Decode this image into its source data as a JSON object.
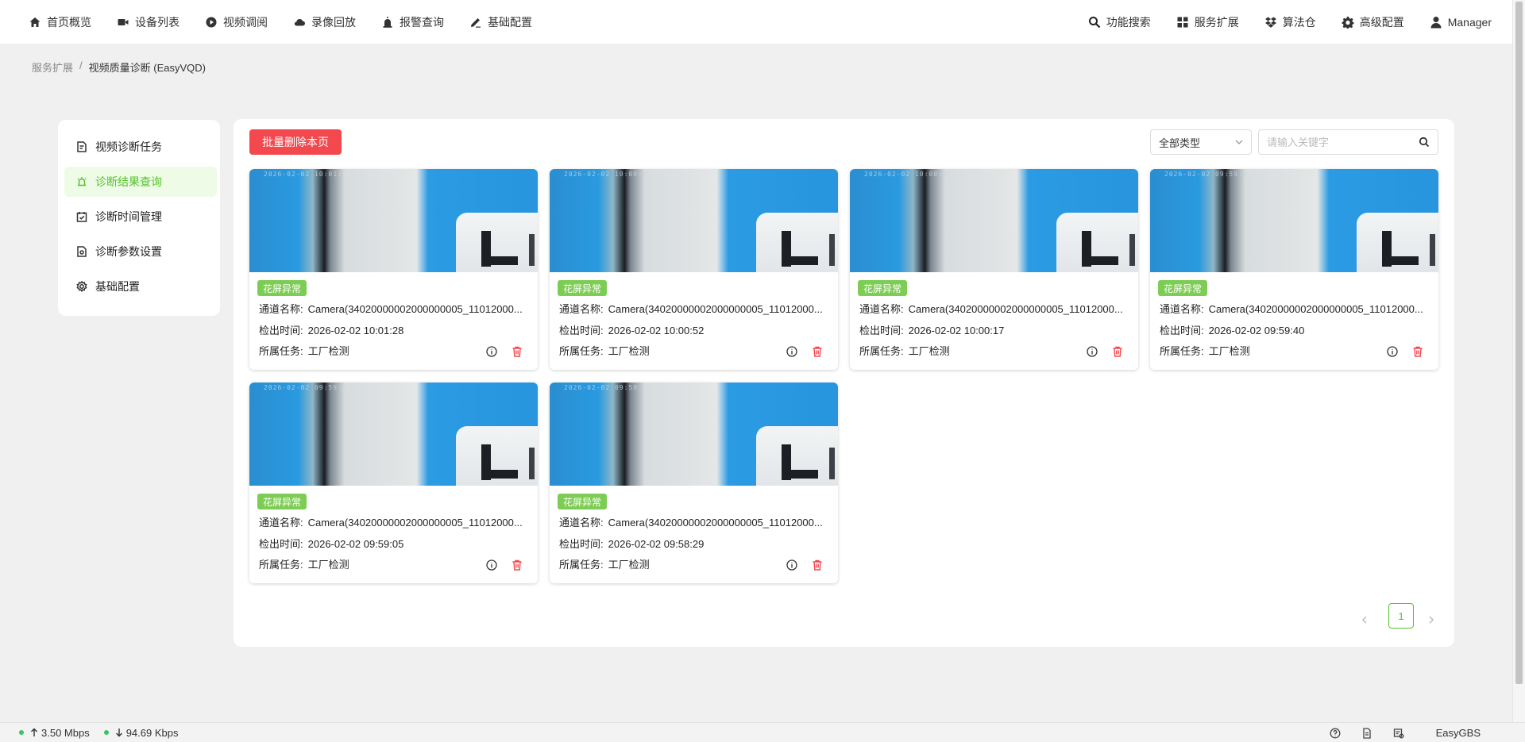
{
  "nav": {
    "left": [
      {
        "label": "首页概览",
        "icon": "home-icon"
      },
      {
        "label": "设备列表",
        "icon": "camera-icon"
      },
      {
        "label": "视频调阅",
        "icon": "play-circle-icon"
      },
      {
        "label": "录像回放",
        "icon": "cloud-icon"
      },
      {
        "label": "报警查询",
        "icon": "alarm-icon"
      },
      {
        "label": "基础配置",
        "icon": "edit-icon"
      }
    ],
    "right": [
      {
        "label": "功能搜索",
        "icon": "search-icon"
      },
      {
        "label": "服务扩展",
        "icon": "apps-icon"
      },
      {
        "label": "算法仓",
        "icon": "dropbox-icon"
      },
      {
        "label": "高级配置",
        "icon": "gear-icon"
      },
      {
        "label": "Manager",
        "icon": "user-icon"
      }
    ]
  },
  "breadcrumb": {
    "parent": "服务扩展",
    "separator": "/",
    "current": "视频质量诊断 (EasyVQD)"
  },
  "sidemenu": {
    "items": [
      {
        "label": "视频诊断任务",
        "icon": "task-icon",
        "active": false
      },
      {
        "label": "诊断结果查询",
        "icon": "alarm-light-icon",
        "active": true
      },
      {
        "label": "诊断时间管理",
        "icon": "calendar-check-icon",
        "active": false
      },
      {
        "label": "诊断参数设置",
        "icon": "settings-doc-icon",
        "active": false
      },
      {
        "label": "基础配置",
        "icon": "gear-icon",
        "active": false
      }
    ]
  },
  "toolbar": {
    "batch_delete_label": "批量删除本页",
    "type_select_value": "全部类型",
    "search_placeholder": "请输入关键字"
  },
  "card_labels": {
    "channel": "通道名称:",
    "time": "检出时间:",
    "task": "所属任务:"
  },
  "cards": [
    {
      "tag": "花屏异常",
      "channel": "Camera(34020000002000000005_11012000...",
      "time": "2026-02-02 10:01:28",
      "task": "工厂检测",
      "timestamp_overlay": "2026-02-02 10:01:2"
    },
    {
      "tag": "花屏异常",
      "channel": "Camera(34020000002000000005_11012000...",
      "time": "2026-02-02 10:00:52",
      "task": "工厂检测",
      "timestamp_overlay": "2026-02-02 10:00:5"
    },
    {
      "tag": "花屏异常",
      "channel": "Camera(34020000002000000005_11012000...",
      "time": "2026-02-02 10:00:17",
      "task": "工厂检测",
      "timestamp_overlay": "2026-02-02 10:00:1"
    },
    {
      "tag": "花屏异常",
      "channel": "Camera(34020000002000000005_11012000...",
      "time": "2026-02-02 09:59:40",
      "task": "工厂检测",
      "timestamp_overlay": "2026-02-02 09:59:4"
    },
    {
      "tag": "花屏异常",
      "channel": "Camera(34020000002000000005_11012000...",
      "time": "2026-02-02 09:59:05",
      "task": "工厂检测",
      "timestamp_overlay": "2026-02-02 09:59:0"
    },
    {
      "tag": "花屏异常",
      "channel": "Camera(34020000002000000005_11012000...",
      "time": "2026-02-02 09:58:29",
      "task": "工厂检测",
      "timestamp_overlay": "2026-02-02 09:58:2"
    }
  ],
  "pagination": {
    "current_page": "1"
  },
  "statusbar": {
    "upload": "3.50 Mbps",
    "download": "94.69 Kbps",
    "brand": "EasyGBS"
  },
  "colors": {
    "accent_green": "#57c22d",
    "tag_green": "#7dcd55",
    "danger_red": "#f2484e"
  }
}
